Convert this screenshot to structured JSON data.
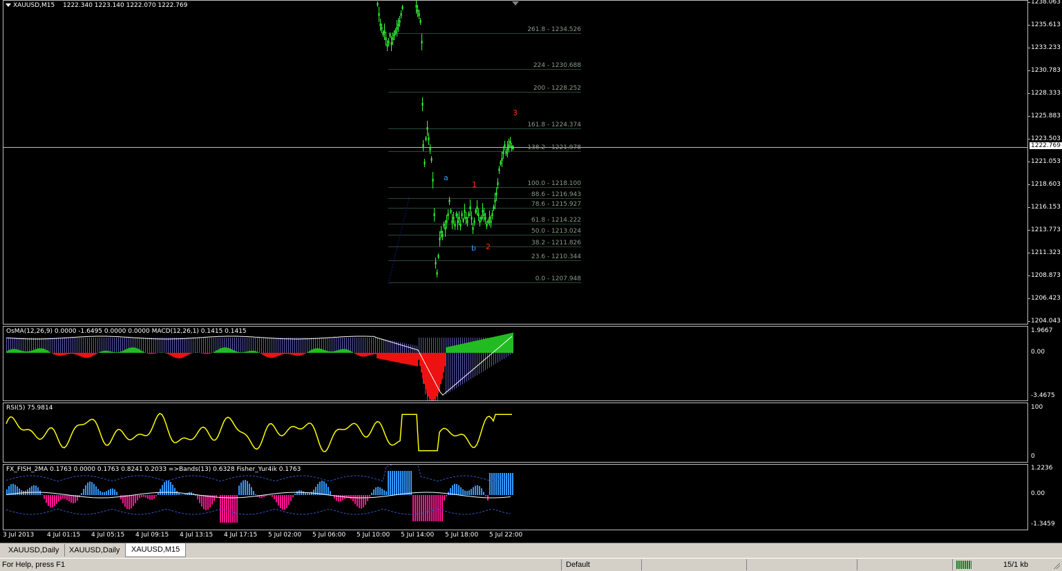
{
  "main_chart": {
    "symbol_label": "XAUUSD,M15",
    "ohlc_label": "1222.340 1223.140 1222.070 1222.769",
    "current_price": "1222.769",
    "price_ticks": [
      "1238.063",
      "1235.613",
      "1233.233",
      "1230.783",
      "1228.333",
      "1225.883",
      "1223.503",
      "1221.053",
      "1218.603",
      "1216.153",
      "1213.773",
      "1211.323",
      "1208.873",
      "1206.423",
      "1204.043"
    ],
    "fib_levels": [
      "261.8 - 1234.526",
      "224 - 1230.688",
      "200 - 1228.252",
      "161.8 - 1224.374",
      "138.2 - 1221.978",
      "100.0 - 1218.100",
      "88.6 - 1216.943",
      "78.6 - 1215.927",
      "61.8 - 1214.222",
      "50.0 - 1213.024",
      "38.2 - 1211.826",
      "23.6 - 1210.344",
      "0.0 - 1207.948"
    ],
    "wave_labels": {
      "a": "a",
      "b": "b",
      "one": "1",
      "two": "2",
      "three": "3"
    },
    "colors": {
      "candle": "#33ff33",
      "fib_line": "#2a4a3a",
      "current_line": "#c0c0c0",
      "wave_blue": "#3399ff",
      "wave_red": "#ff3300"
    }
  },
  "osma_pane": {
    "label": "OsMA(12,26,9) 0.0000 -1.6495 0.0000 0.0000  MACD(12,26,1) 0.1415 0.1415",
    "ticks": [
      "1.9667",
      "0.00",
      "-3.4675"
    ]
  },
  "rsi_pane": {
    "label": "RSI(5) 75.9814",
    "ticks": [
      "100",
      "0"
    ]
  },
  "fish_pane": {
    "label": "FX_FISH_2MA 0.1763 0.0000 0.1763 0.8241 0.2033  =>Bands(13) 0.6328  Fisher_Yur4ik 0.1763",
    "ticks": [
      "1.2236",
      "0.00",
      "-1.3459"
    ]
  },
  "time_axis": [
    "3 Jul 2013",
    "4 Jul 01:15",
    "4 Jul 05:15",
    "4 Jul 09:15",
    "4 Jul 13:15",
    "4 Jul 17:15",
    "5 Jul 02:00",
    "5 Jul 06:00",
    "5 Jul 10:00",
    "5 Jul 14:00",
    "5 Jul 18:00",
    "5 Jul 22:00"
  ],
  "tabs": [
    "XAUUSD,Daily",
    "XAUUSD,Daily",
    "XAUUSD,M15"
  ],
  "status": {
    "help": "For Help, press F1",
    "profile": "Default",
    "traffic": "15/1 kb"
  }
}
